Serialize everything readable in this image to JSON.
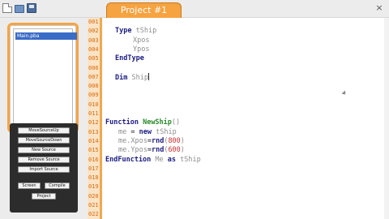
{
  "toolbar": {
    "new_icon": "new-file-icon",
    "open_icon": "open-folder-icon",
    "save_icon": "save-disk-icon",
    "close_glyph": "×"
  },
  "tab": {
    "label": "Project #1",
    "color": "#f6a341"
  },
  "files": {
    "items": [
      "Main.pba"
    ]
  },
  "buttons": {
    "move_up": "MoveSourceUp",
    "move_down": "MoveSourceDown",
    "new_source": "New Source",
    "remove_source": "Remove Source",
    "import_source": "Import Source",
    "screen": "Screen",
    "compile": "Compile",
    "project": "Project"
  },
  "editor": {
    "line_numbers": [
      "001",
      "002",
      "003",
      "004",
      "005",
      "006",
      "007",
      "008",
      "009",
      "010",
      "011",
      "012",
      "013",
      "014",
      "015",
      "016",
      "017",
      "018",
      "019",
      "020",
      "021",
      "022"
    ],
    "line1": {
      "kw": "Type",
      "id": "tShip"
    },
    "line2": {
      "id": "Xpos"
    },
    "line3": {
      "id": "Ypos"
    },
    "line4": {
      "kw": "EndType"
    },
    "line6": {
      "kw": "Dim",
      "id": "Ship"
    },
    "line11": {
      "kw": "Function",
      "fn": "NewShip",
      "op": "()"
    },
    "line12": {
      "id1": "me",
      "op": " = ",
      "kw": "new",
      "id2": "tShip"
    },
    "line13": {
      "id": "me.Xpos",
      "op1": "=",
      "fn": "rnd",
      "op2": "(",
      "num": "800",
      "op3": ")"
    },
    "line14": {
      "id": "me.Ypos",
      "op1": "=",
      "fn": "rnd",
      "op2": "(",
      "num": "600",
      "op3": ")"
    },
    "line15": {
      "kw1": "EndFunction",
      "id1": "Me",
      "kw2": "as",
      "id2": "tShip"
    }
  },
  "colors": {
    "accent": "#f6a341",
    "keyword": "#1a1a80",
    "function": "#2a8a2a",
    "number": "#c82f2f",
    "identifier": "#8e8e8e",
    "line_number": "#d86b0d"
  }
}
